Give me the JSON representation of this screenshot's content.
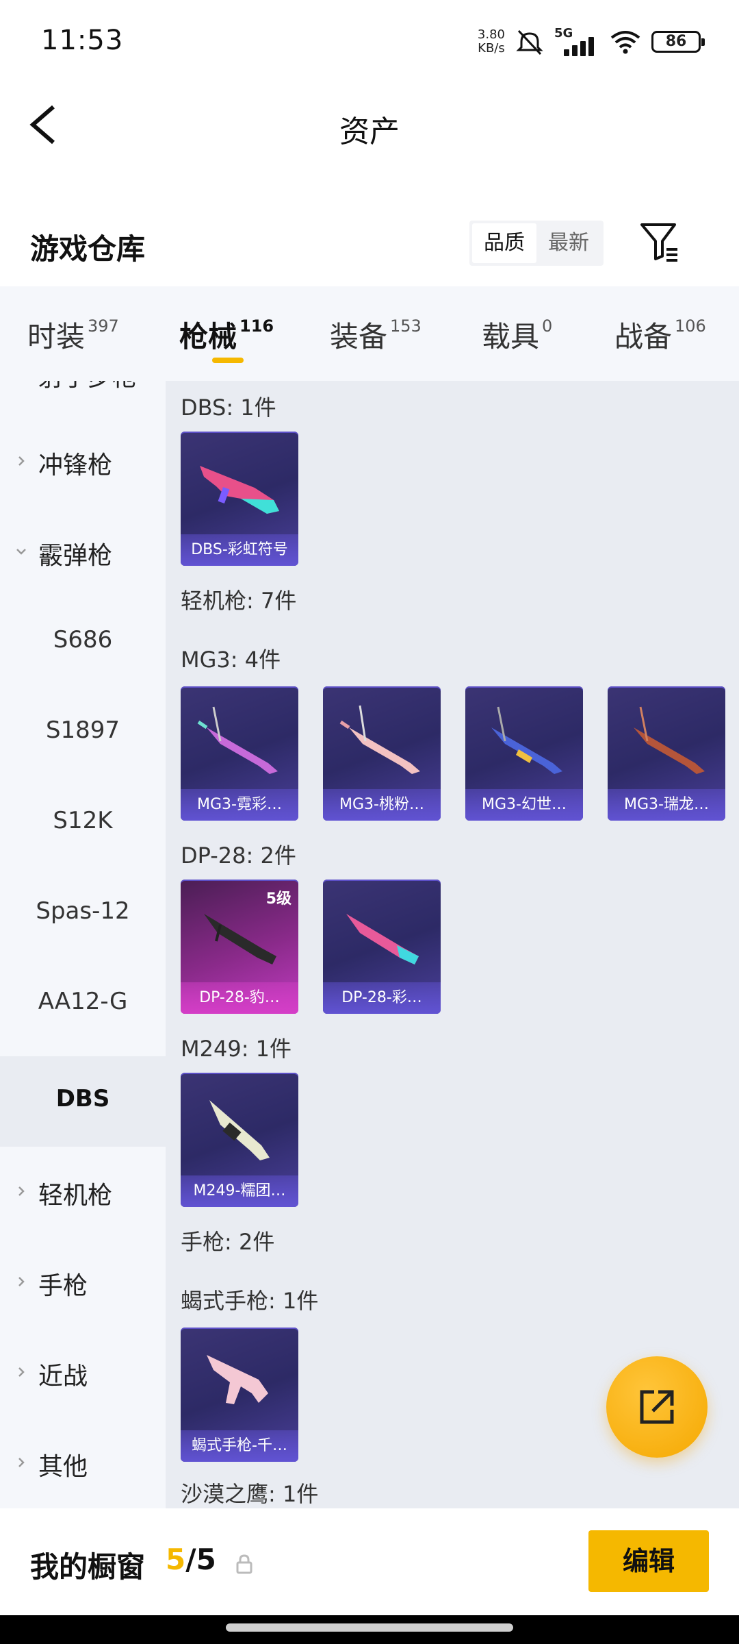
{
  "status_bar": {
    "time": "11:53",
    "net_speed_value": "3.80",
    "net_speed_unit": "KB/s",
    "network_label": "5G",
    "battery": "86"
  },
  "header": {
    "title": "资产",
    "back_icon": "chevron-left-icon"
  },
  "section": {
    "title": "游戏仓库",
    "sort_options": [
      "品质",
      "最新"
    ],
    "sort_selected": "品质",
    "filter_icon": "filter-icon"
  },
  "tabs": [
    {
      "label": "时装",
      "count": "397"
    },
    {
      "label": "枪械",
      "count": "116",
      "active": true
    },
    {
      "label": "装备",
      "count": "153"
    },
    {
      "label": "载具",
      "count": "0"
    },
    {
      "label": "战备",
      "count": "106"
    }
  ],
  "sidebar": {
    "partial_top": "射手步枪",
    "items": [
      {
        "label": "冲锋枪"
      },
      {
        "label": "霰弹枪",
        "expanded": true
      },
      {
        "label": "S686"
      },
      {
        "label": "S1897"
      },
      {
        "label": "S12K"
      },
      {
        "label": "Spas-12"
      },
      {
        "label": "AA12-G"
      },
      {
        "label": "DBS",
        "selected": true
      },
      {
        "label": "轻机枪"
      },
      {
        "label": "手枪"
      },
      {
        "label": "近战"
      },
      {
        "label": "其他"
      }
    ]
  },
  "content": {
    "labels": {
      "dbs": "DBS: 1件",
      "lmg": "轻机枪: 7件",
      "mg3": "MG3: 4件",
      "dp28": "DP-28: 2件",
      "m249": "M249: 1件",
      "pistol": "手枪: 2件",
      "scorpion": "蝎式手枪: 1件",
      "deagle": "沙漠之鹰: 1件"
    },
    "cards": {
      "dbs": [
        "DBS-彩虹符号"
      ],
      "mg3": [
        "MG3-霓彩…",
        "MG3-桃粉…",
        "MG3-幻世…",
        "MG3-瑞龙…"
      ],
      "dp28": [
        "DP-28-豹…",
        "DP-28-彩…"
      ],
      "dp28_level": "5级",
      "m249": [
        "M249-糯团…"
      ],
      "scorpion": [
        "蝎式手枪-千…"
      ]
    }
  },
  "fab": {
    "icon": "share-external-icon"
  },
  "bottom_bar": {
    "title": "我的橱窗",
    "count_current": "5",
    "count_sep": "/",
    "count_total": "5",
    "lock_icon": "lock-icon",
    "edit_label": "编辑"
  },
  "colors": {
    "accent": "#f5b800",
    "card_purple": "#3b3474",
    "card_pink": "#c03cc0",
    "content_bg": "#e9ecf2",
    "sidebar_bg": "#f5f7fb"
  }
}
